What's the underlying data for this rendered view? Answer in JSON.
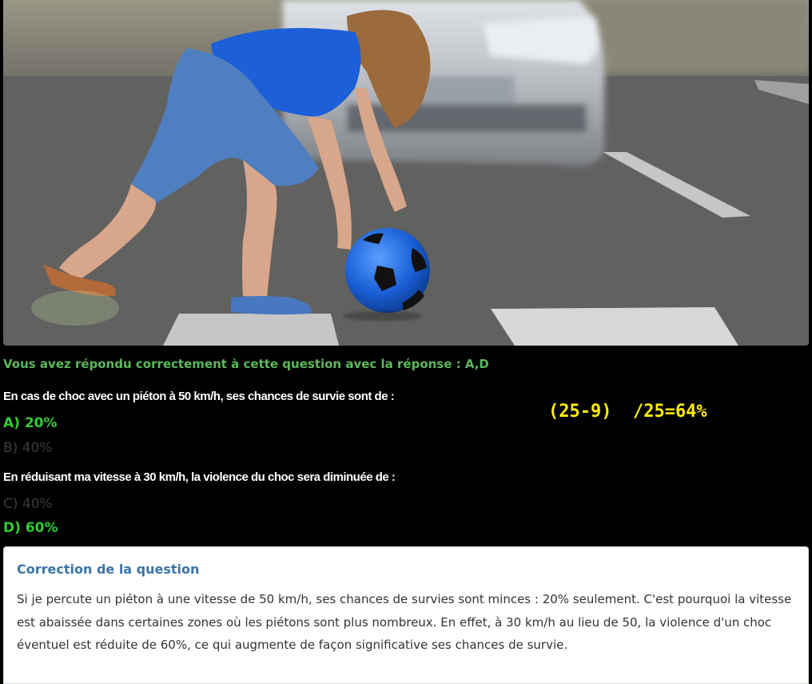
{
  "photo": {
    "alt": "Enfant ramassant un ballon bleu sur un passage piéton devant une voiture"
  },
  "result": {
    "message": "Vous avez répondu correctement à cette question avec la réponse : A,D"
  },
  "questions": [
    {
      "text": "En cas de choc avec un piéton à 50 km/h, ses chances de survie sont de :",
      "answers": [
        {
          "label": "A) 20%",
          "correct": true
        },
        {
          "label": "B) 40%",
          "correct": false
        }
      ]
    },
    {
      "text": "En réduisant ma vitesse à 30 km/h, la violence du choc sera diminuée de :",
      "answers": [
        {
          "label": "C) 40%",
          "correct": false
        },
        {
          "label": "D) 60%",
          "correct": true
        }
      ]
    }
  ],
  "calculation": "(25-9)  /25=64%",
  "correction": {
    "title": "Correction de la question",
    "body": "Si je percute un piéton à une vitesse de 50 km/h, ses chances de survies sont minces : 20% seulement. C'est pourquoi la vitesse est abaissée dans certaines zones où les piétons sont plus nombreux. En effet, à 30 km/h au lieu de 50, la violence d'un choc éventuel est réduite de 60%, ce qui augmente de façon significative ses chances de survie."
  },
  "colors": {
    "correct_answer": "#33cc33",
    "wrong_answer": "#3c3c3c",
    "result_message": "#5cb85c",
    "calculation": "#ffee00",
    "panel_title": "#3a73a8"
  }
}
